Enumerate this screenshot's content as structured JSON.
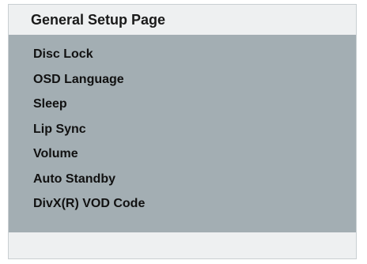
{
  "page": {
    "title": "General Setup Page"
  },
  "menu": {
    "items": [
      {
        "label": "Disc Lock"
      },
      {
        "label": "OSD Language"
      },
      {
        "label": "Sleep"
      },
      {
        "label": "Lip Sync"
      },
      {
        "label": "Volume"
      },
      {
        "label": "Auto Standby"
      },
      {
        "label": "DivX(R) VOD Code"
      }
    ]
  },
  "colors": {
    "panel_background": "#a3aeb3",
    "header_background": "#eef0f1",
    "text": "#111111"
  }
}
